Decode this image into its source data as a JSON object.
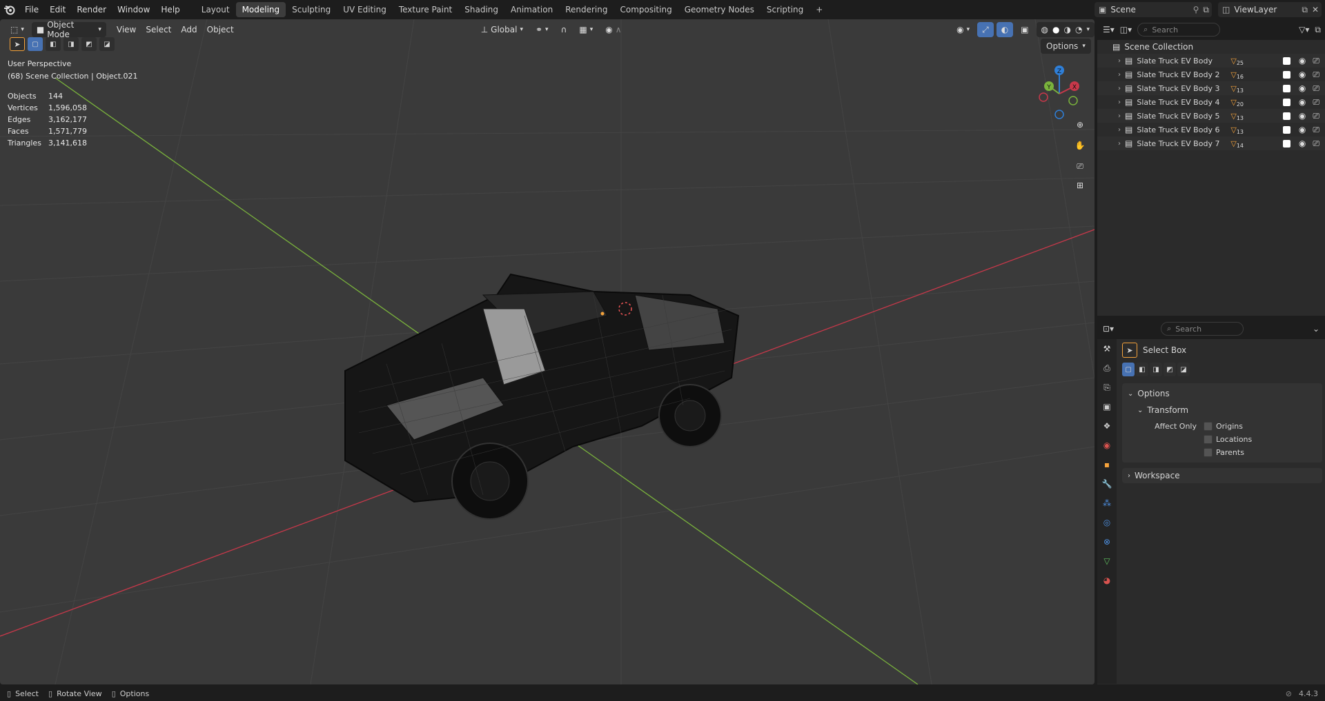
{
  "topbar": {
    "menu": [
      "File",
      "Edit",
      "Render",
      "Window",
      "Help"
    ],
    "workspaces": [
      "Layout",
      "Modeling",
      "Sculpting",
      "UV Editing",
      "Texture Paint",
      "Shading",
      "Animation",
      "Rendering",
      "Compositing",
      "Geometry Nodes",
      "Scripting"
    ],
    "active_workspace": "Modeling",
    "add_label": "+",
    "scene": "Scene",
    "view_layer": "ViewLayer"
  },
  "viewport": {
    "mode": "Object Mode",
    "menus": [
      "View",
      "Select",
      "Add",
      "Object"
    ],
    "transform_orientation": "Global",
    "options_label": "Options",
    "perspective_label": "User Perspective",
    "collection_label": "(68) Scene Collection | Object.021",
    "stats": [
      {
        "key": "Objects",
        "value": "144"
      },
      {
        "key": "Vertices",
        "value": "1,596,058"
      },
      {
        "key": "Edges",
        "value": "3,162,177"
      },
      {
        "key": "Faces",
        "value": "1,571,779"
      },
      {
        "key": "Triangles",
        "value": "3,141,618"
      }
    ],
    "gizmo_axes": {
      "x": "X",
      "y": "Y",
      "z": "Z"
    },
    "colors": {
      "x_axis": "#c8384a",
      "y_axis": "#7ab33c",
      "z_axis": "#2f7fd8",
      "background": "#3a3a3a"
    }
  },
  "outliner": {
    "search_placeholder": "Search",
    "root": "Scene Collection",
    "items": [
      {
        "label": "Slate Truck EV Body",
        "badge": "25"
      },
      {
        "label": "Slate Truck EV Body 2",
        "badge": "16"
      },
      {
        "label": "Slate Truck EV Body 3",
        "badge": "13"
      },
      {
        "label": "Slate Truck EV Body 4",
        "badge": "20"
      },
      {
        "label": "Slate Truck EV Body 5",
        "badge": "13"
      },
      {
        "label": "Slate Truck EV Body 6",
        "badge": "13"
      },
      {
        "label": "Slate Truck EV Body 7",
        "badge": "14"
      }
    ]
  },
  "properties": {
    "search_placeholder": "Search",
    "tool_name": "Select Box",
    "options_label": "Options",
    "transform_label": "Transform",
    "affect_only_label": "Affect Only",
    "affect_options": [
      "Origins",
      "Locations",
      "Parents"
    ],
    "workspace_label": "Workspace"
  },
  "statusbar": {
    "items": [
      "Select",
      "Rotate View",
      "Options"
    ],
    "version": "4.4.3"
  }
}
